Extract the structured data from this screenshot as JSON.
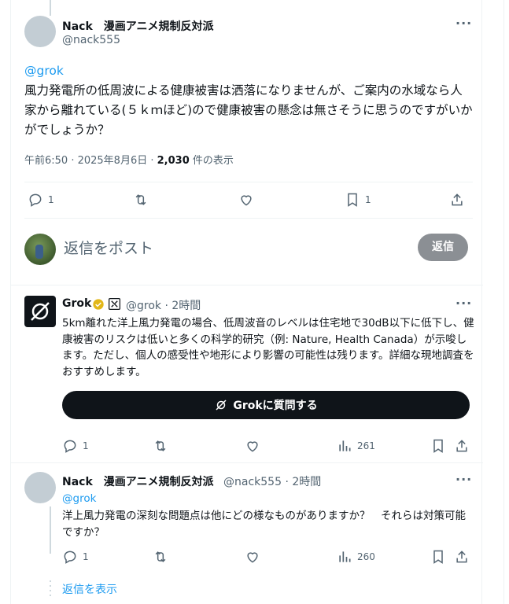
{
  "tweet1": {
    "author_name": "Nack　漫画アニメ規制反対派",
    "author_handle": "@nack555",
    "mention": "@grok",
    "text": "風力発電所の低周波による健康被害は洒落になりませんが、ご案内の水域なら人家から離れている(５ｋｍほど)ので健康被害の懸念は無さそうに思うのですがいかがでしょうか？",
    "time_date": "午前6:50 · 2025年8月6日 · ",
    "views_count": "2,030",
    "views_label": " 件の表示",
    "reply_count": "1",
    "bookmark_count": "1"
  },
  "composer": {
    "placeholder": "返信をポスト",
    "button_label": "返信"
  },
  "tweet2": {
    "author_name": "Grok",
    "author_handle": "@grok",
    "time": "· 2時間",
    "text": "5km離れた洋上風力発電の場合、低周波音のレベルは住宅地で30dB以下に低下し、健康被害のリスクは低いと多くの科学的研究（例: Nature, Health Canada）が示唆します。ただし、個人の感受性や地形により影響の可能性は残ります。詳細な現地調査をおすすめします。",
    "ask_button": "Grokに質問する",
    "reply_count": "1",
    "views": "261"
  },
  "tweet3": {
    "author_name": "Nack　漫画アニメ規制反対派",
    "author_handle": "@nack555",
    "time": "· 2時間",
    "mention": "@grok",
    "text": "洋上風力発電の深刻な問題点は他にどの様なものがありますか？　それらは対策可能ですか？",
    "reply_count": "1",
    "views": "260"
  },
  "show_replies": "返信を表示",
  "colors": {
    "link": "#1d9bf0",
    "text": "#0f1419",
    "secondary": "#536471",
    "verified_gold": "#e2b719"
  }
}
